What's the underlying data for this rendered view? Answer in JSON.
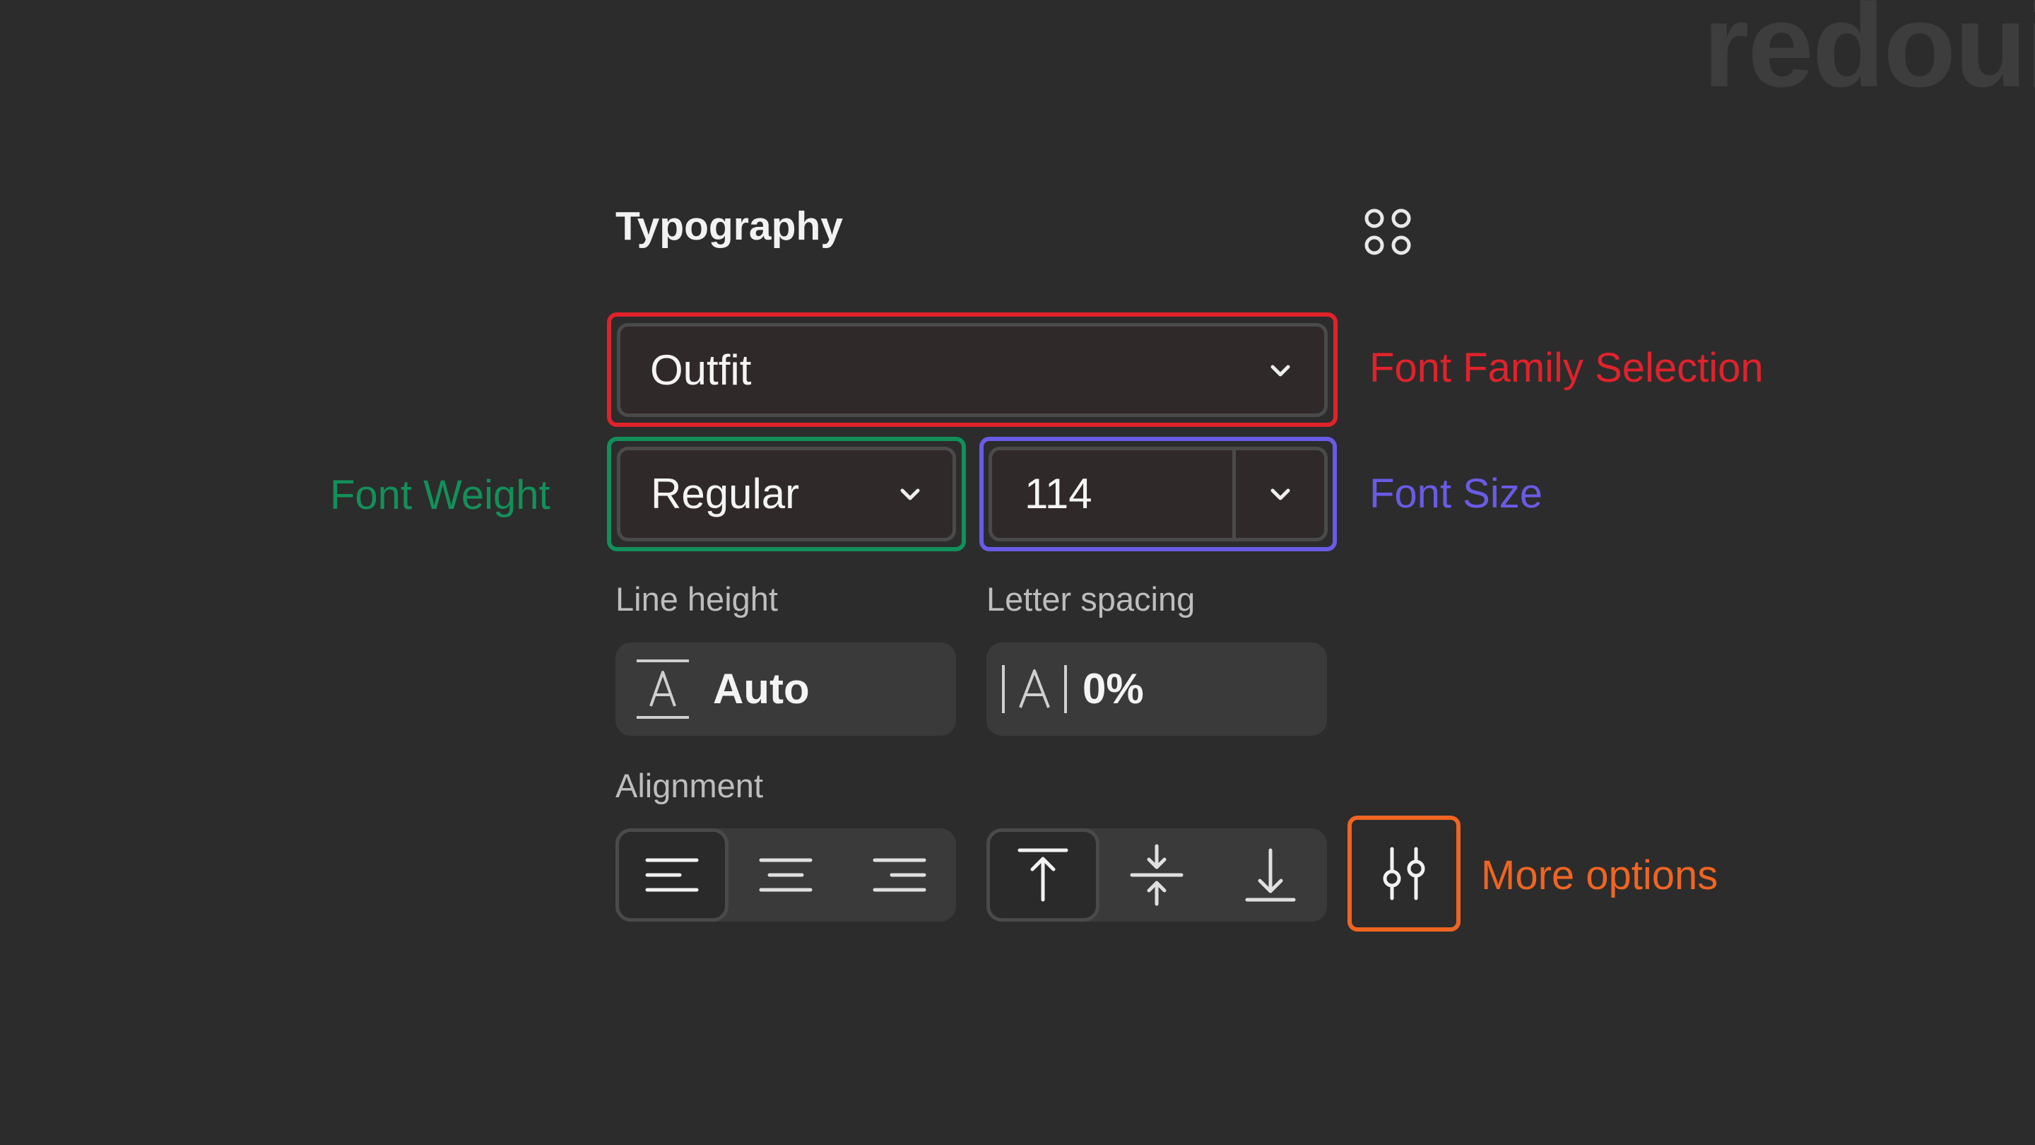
{
  "watermark": "redoui",
  "panel": {
    "title": "Typography",
    "font_family": {
      "value": "Outfit"
    },
    "font_weight": {
      "value": "Regular"
    },
    "font_size": {
      "value": "114"
    },
    "line_height": {
      "label": "Line height",
      "value": "Auto"
    },
    "letter_spacing": {
      "label": "Letter spacing",
      "value": "0%"
    },
    "alignment": {
      "label": "Alignment",
      "horizontal": [
        {
          "name": "align-left",
          "active": true
        },
        {
          "name": "align-center",
          "active": false
        },
        {
          "name": "align-right",
          "active": false
        }
      ],
      "vertical": [
        {
          "name": "align-top",
          "active": true
        },
        {
          "name": "align-middle",
          "active": false
        },
        {
          "name": "align-bottom",
          "active": false
        }
      ]
    }
  },
  "annotations": {
    "font_family": "Font Family Selection",
    "font_weight": "Font Weight",
    "font_size": "Font Size",
    "more_options": "More options"
  },
  "colors": {
    "background": "#2c2c2c",
    "annotation_red": "#e0222b",
    "annotation_green": "#12905a",
    "annotation_blue": "#6a5be6",
    "annotation_orange": "#ef6522"
  },
  "icons": {
    "panel_options": "four-circles-icon",
    "dropdown": "chevron-down-icon",
    "line_height": "line-height-icon",
    "letter_spacing": "letter-spacing-icon",
    "more_options": "sliders-icon"
  }
}
